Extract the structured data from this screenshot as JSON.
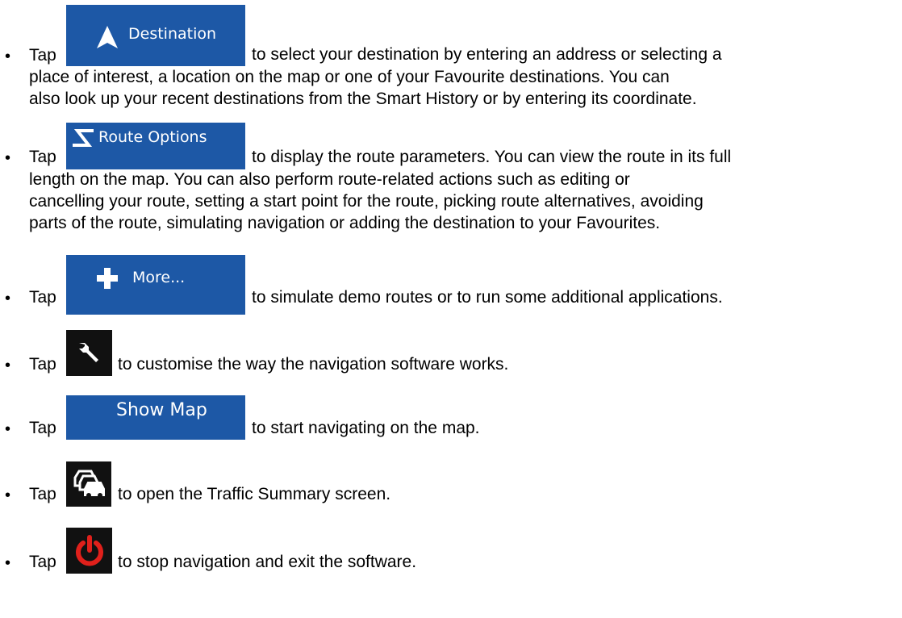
{
  "tap_word": "Tap",
  "items": [
    {
      "button_label": "Destination",
      "button_icon": "navigation-arrow-icon",
      "text_first": "to select your destination by entering an address or selecting a",
      "text_rest": [
        "place of interest, a location on the map or one of your Favourite destinations. You can",
        "also look up your recent destinations from the Smart History or by entering its coordinate."
      ]
    },
    {
      "button_label": "Route Options",
      "button_icon": "route-s-icon",
      "text_first": "to display the route parameters. You can view the route in its full",
      "text_rest": [
        "length on the map. You can also perform route-related actions such as editing or",
        "cancelling your route, setting a start point for the route, picking route alternatives, avoiding",
        "parts of the route, simulating navigation or adding the destination to your Favourites."
      ]
    },
    {
      "button_label": "More...",
      "button_icon": "plus-icon",
      "text_first": "to simulate demo routes or to run some additional applications."
    },
    {
      "button_icon": "wrench-icon",
      "text_first": "to customise the way the navigation software works."
    },
    {
      "button_label": "Show Map",
      "text_first": "to start navigating on the map."
    },
    {
      "button_icon": "traffic-cars-icon",
      "text_first": "to open the Traffic Summary screen."
    },
    {
      "button_icon": "power-icon",
      "text_first": "to stop navigation and exit the software."
    }
  ],
  "colors": {
    "button_blue": "#1d58a6",
    "button_dark": "#111111",
    "power_red": "#e0201b"
  }
}
